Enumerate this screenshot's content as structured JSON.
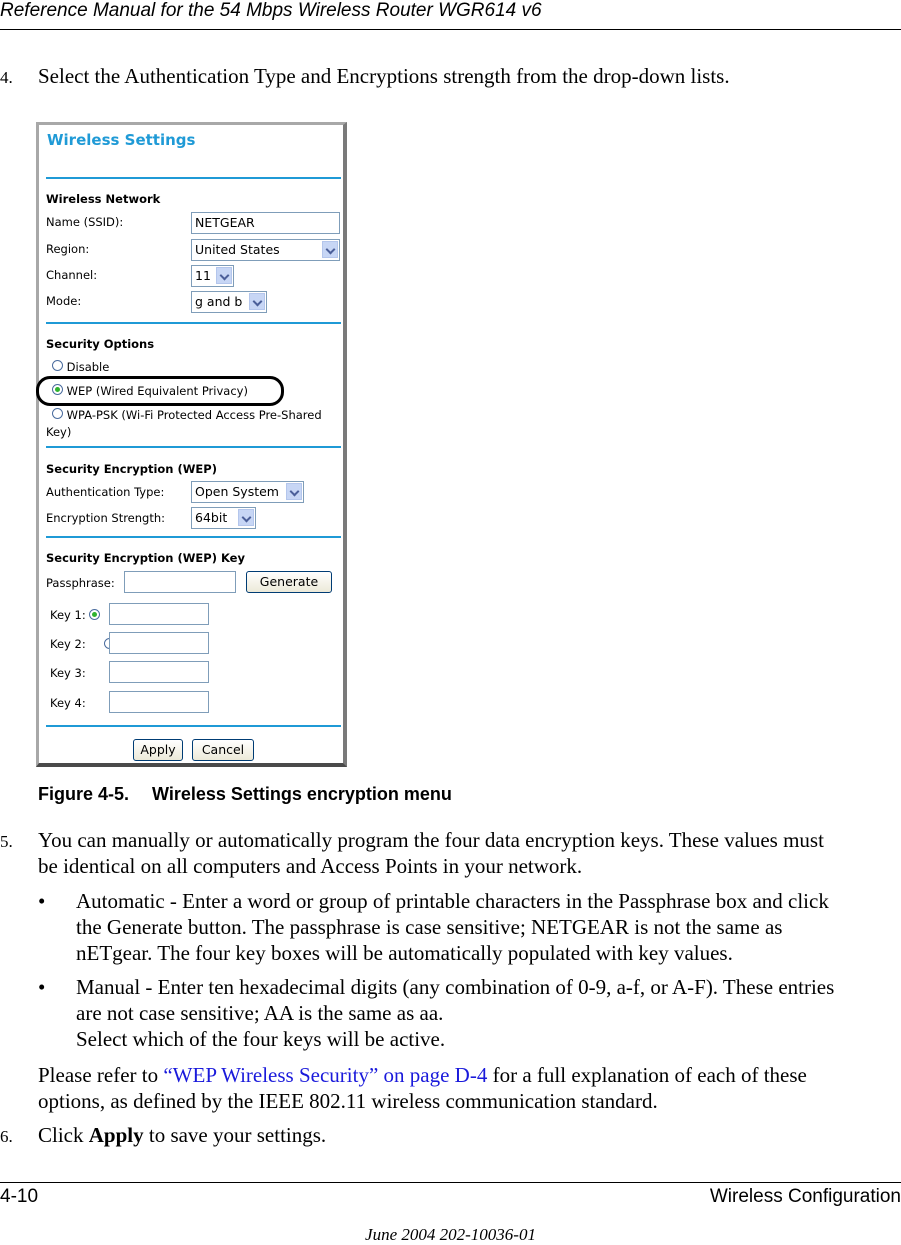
{
  "header": {
    "title": "Reference Manual for the 54 Mbps Wireless Router WGR614 v6"
  },
  "steps": {
    "step4": {
      "number": "4.",
      "text": "Select the Authentication Type and Encryptions strength from the drop-down lists."
    },
    "step5": {
      "number": "5.",
      "line1": "You can manually or automatically program the four data encryption keys. These values must",
      "line2": "be identical on all computers and Access Points in your network."
    },
    "bullet_auto": {
      "bullet": "•",
      "line1": "Automatic - Enter a word or group of printable characters in the Passphrase box and click",
      "line2": "the Generate button. The passphrase is case sensitive; NETGEAR is not the same as",
      "line3": "nETgear. The four key boxes will be automatically populated with key values."
    },
    "bullet_manual": {
      "bullet": "•",
      "line1": "Manual - Enter ten hexadecimal digits (any combination of 0-9, a-f, or A-F). These entries",
      "line2": "are not case sensitive; AA is the same as aa.",
      "line3": "Select which of the four keys will be active."
    },
    "refer": {
      "prefix": "Please refer to ",
      "link": "“WEP Wireless Security” on page D-4",
      "suffix": " for a full explanation of each of these",
      "line2": "options, as defined by the IEEE 802.11 wireless communication standard."
    },
    "step6": {
      "number": "6.",
      "pre": "Click ",
      "bold": "Apply",
      "post": " to save your settings."
    }
  },
  "figure": {
    "caption_label": "Figure 4-5.",
    "caption_text": "Wireless Settings encryption menu",
    "ui": {
      "title": "Wireless Settings",
      "wireless_network": {
        "heading": "Wireless Network",
        "ssid_label": "Name (SSID):",
        "ssid_value": "NETGEAR",
        "region_label": "Region:",
        "region_value": "United States",
        "channel_label": "Channel:",
        "channel_value": "11",
        "mode_label": "Mode:",
        "mode_value": "g and b"
      },
      "security_options": {
        "heading": "Security Options",
        "disable": "Disable",
        "wep": "WEP (Wired Equivalent Privacy)",
        "wpa_line1": "WPA-PSK (Wi-Fi Protected Access Pre-Shared",
        "wpa_line2": "Key)",
        "selected": "wep"
      },
      "wep_encryption": {
        "heading": "Security Encryption (WEP)",
        "auth_label": "Authentication Type:",
        "auth_value": "Open System",
        "strength_label": "Encryption Strength:",
        "strength_value": "64bit"
      },
      "wep_key": {
        "heading": "Security Encryption (WEP) Key",
        "passphrase_label": "Passphrase:",
        "passphrase_value": "",
        "generate": "Generate",
        "keys": [
          {
            "label": "Key 1:",
            "value": "",
            "active": true
          },
          {
            "label": "Key 2:",
            "value": "",
            "active": false
          },
          {
            "label": "Key 3:",
            "value": "",
            "active": false
          },
          {
            "label": "Key 4:",
            "value": "",
            "active": false
          }
        ]
      },
      "apply": "Apply",
      "cancel": "Cancel"
    }
  },
  "footer": {
    "page": "4-10",
    "section": "Wireless Configuration",
    "date": "June 2004 202-10036-01"
  }
}
